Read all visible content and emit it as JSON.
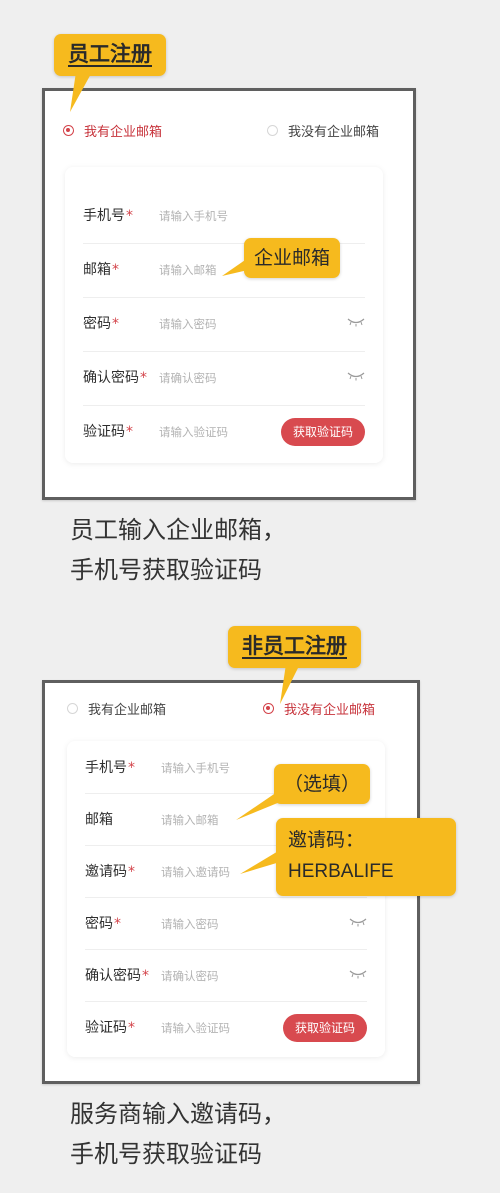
{
  "section1": {
    "tag": "员工注册",
    "radio": [
      {
        "label": "我有企业邮箱",
        "selected": true
      },
      {
        "label": "我没有企业邮箱",
        "selected": false
      }
    ],
    "fields": {
      "phone": {
        "label": "手机号",
        "required": "*",
        "placeholder": "请输入手机号"
      },
      "email": {
        "label": "邮箱",
        "required": "*",
        "placeholder": "请输入邮箱"
      },
      "password": {
        "label": "密码",
        "required": "*",
        "placeholder": "请输入密码"
      },
      "confirm": {
        "label": "确认密码",
        "required": "*",
        "placeholder": "请确认密码"
      },
      "code": {
        "label": "验证码",
        "required": "*",
        "placeholder": "请输入验证码"
      }
    },
    "code_button": "获取验证码",
    "note_email": "企业邮箱",
    "caption": [
      "员工输入企业邮箱，",
      "手机号获取验证码"
    ]
  },
  "section2": {
    "tag": "非员工注册",
    "radio": [
      {
        "label": "我有企业邮箱",
        "selected": false
      },
      {
        "label": "我没有企业邮箱",
        "selected": true
      }
    ],
    "fields": {
      "phone": {
        "label": "手机号",
        "required": "*",
        "placeholder": "请输入手机号"
      },
      "email": {
        "label": "邮箱",
        "required": "",
        "placeholder": "请输入邮箱"
      },
      "invite": {
        "label": "邀请码",
        "required": "*",
        "placeholder": "请输入邀请码"
      },
      "password": {
        "label": "密码",
        "required": "*",
        "placeholder": "请输入密码"
      },
      "confirm": {
        "label": "确认密码",
        "required": "*",
        "placeholder": "请确认密码"
      },
      "code": {
        "label": "验证码",
        "required": "*",
        "placeholder": "请输入验证码"
      }
    },
    "code_button": "获取验证码",
    "note_optional": "（选填）",
    "note_invite": [
      "邀请码：",
      "HERBALIFE"
    ],
    "caption": [
      "服务商输入邀请码，",
      "手机号获取验证码"
    ]
  },
  "colors": {
    "accent": "#d84a4f",
    "callout": "#f6ba1e",
    "background": "#efefef"
  },
  "icons": {
    "eye": "eye-closed-icon",
    "radio": "radio-icon"
  }
}
